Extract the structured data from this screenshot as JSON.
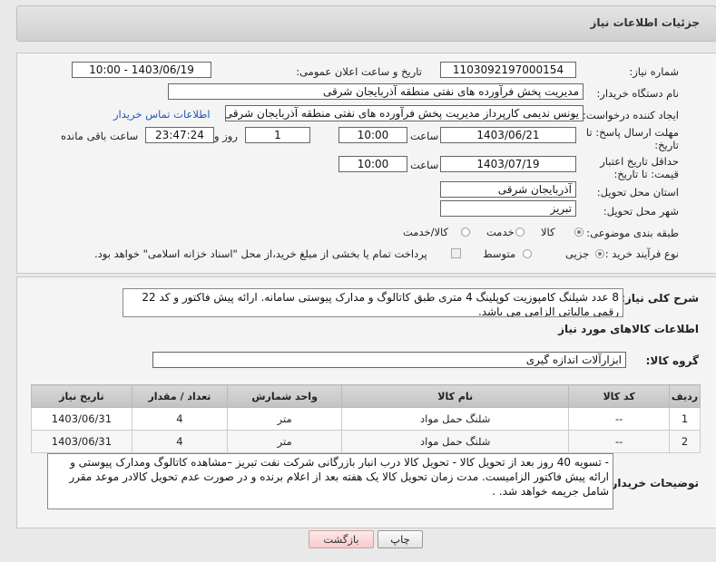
{
  "header": {
    "title": "جزئیات اطلاعات نیاز"
  },
  "form": {
    "need_number": {
      "label": "شماره نیاز:",
      "value": "1103092197000154"
    },
    "announce_datetime": {
      "label": "تاریخ و ساعت اعلان عمومی:",
      "value": "1403/06/19 - 10:00"
    },
    "buyer_org": {
      "label": "نام دستگاه خریدار:",
      "value": "مدیریت پخش فرآورده های نفتی منطقه آذربایجان شرقی"
    },
    "requester": {
      "label": "ایجاد کننده درخواست:",
      "value": "یونس ندیمی کارپرداز مدیریت پخش فرآورده های نفتی منطقه آذربایجان شرقی",
      "contact_link": "اطلاعات تماس خریدار"
    },
    "reply_deadline": {
      "label": "مهلت ارسال پاسخ: تا تاریخ:",
      "date": "1403/06/21",
      "time_label": "ساعت",
      "time": "10:00",
      "days": "1",
      "days_label": "روز و",
      "remaining": "23:47:24",
      "remaining_label": "ساعت باقی مانده"
    },
    "price_validity": {
      "label": "حداقل تاریخ اعتبار قیمت: تا تاریخ:",
      "date": "1403/07/19",
      "time_label": "ساعت",
      "time": "10:00"
    },
    "delivery_province": {
      "label": "استان محل تحویل:",
      "value": "آذربایجان شرقی"
    },
    "delivery_city": {
      "label": "شهر محل تحویل:",
      "value": "تبریز"
    },
    "subject_class": {
      "label": "طبقه بندی موضوعی:",
      "options": [
        "کالا",
        "خدمت",
        "کالا/خدمت"
      ]
    },
    "purchase_type": {
      "label": "نوع فرآیند خرید :",
      "options": [
        "جزیی",
        "متوسط"
      ],
      "note": "پرداخت تمام یا بخشی از مبلغ خرید،از محل \"اسناد خزانه اسلامی\" خواهد بود."
    }
  },
  "general_description": {
    "label": "شرح کلی نیاز:",
    "text": "8 عدد شیلنگ کامپوزیت کوپلینگ 4 متری طبق کاتالوگ و مدارک پیوستی سامانه. ارائه پیش فاکتور و کد 22 رقمی مالیاتی الزامی می باشد."
  },
  "items_section": {
    "title": "اطلاعات کالاهای مورد نیاز",
    "group_label": "گروه کالا:",
    "group_value": "ابزارآلات اندازه گیری",
    "columns": [
      "ردیف",
      "کد کالا",
      "نام کالا",
      "واحد شمارش",
      "تعداد / مقدار",
      "تاریخ نیاز"
    ],
    "rows": [
      {
        "row": "1",
        "code": "--",
        "name": "شلنگ حمل مواد",
        "unit": "متر",
        "qty": "4",
        "date": "1403/06/31"
      },
      {
        "row": "2",
        "code": "--",
        "name": "شلنگ حمل مواد",
        "unit": "متر",
        "qty": "4",
        "date": "1403/06/31"
      }
    ]
  },
  "buyer_notes": {
    "label": "توضیحات خریدار:",
    "text": "- تسویه 40 روز بعد از تحویل کالا - تحویل کالا درب انبار بازرگانی شرکت نفت تبریز –مشاهده کاتالوگ ومدارک پیوستی و ارائه پیش فاکتور الزامیست. مدت زمان تحویل کالا یک هفته بعد از اعلام برنده و در صورت عدم تحویل کالادر موعد مقرر شامل جریمه خواهد شد. ."
  },
  "buttons": {
    "print": "چاپ",
    "back": "بازگشت"
  },
  "colors": {
    "link": "#1f55c0",
    "back_button": "#f7caca"
  }
}
